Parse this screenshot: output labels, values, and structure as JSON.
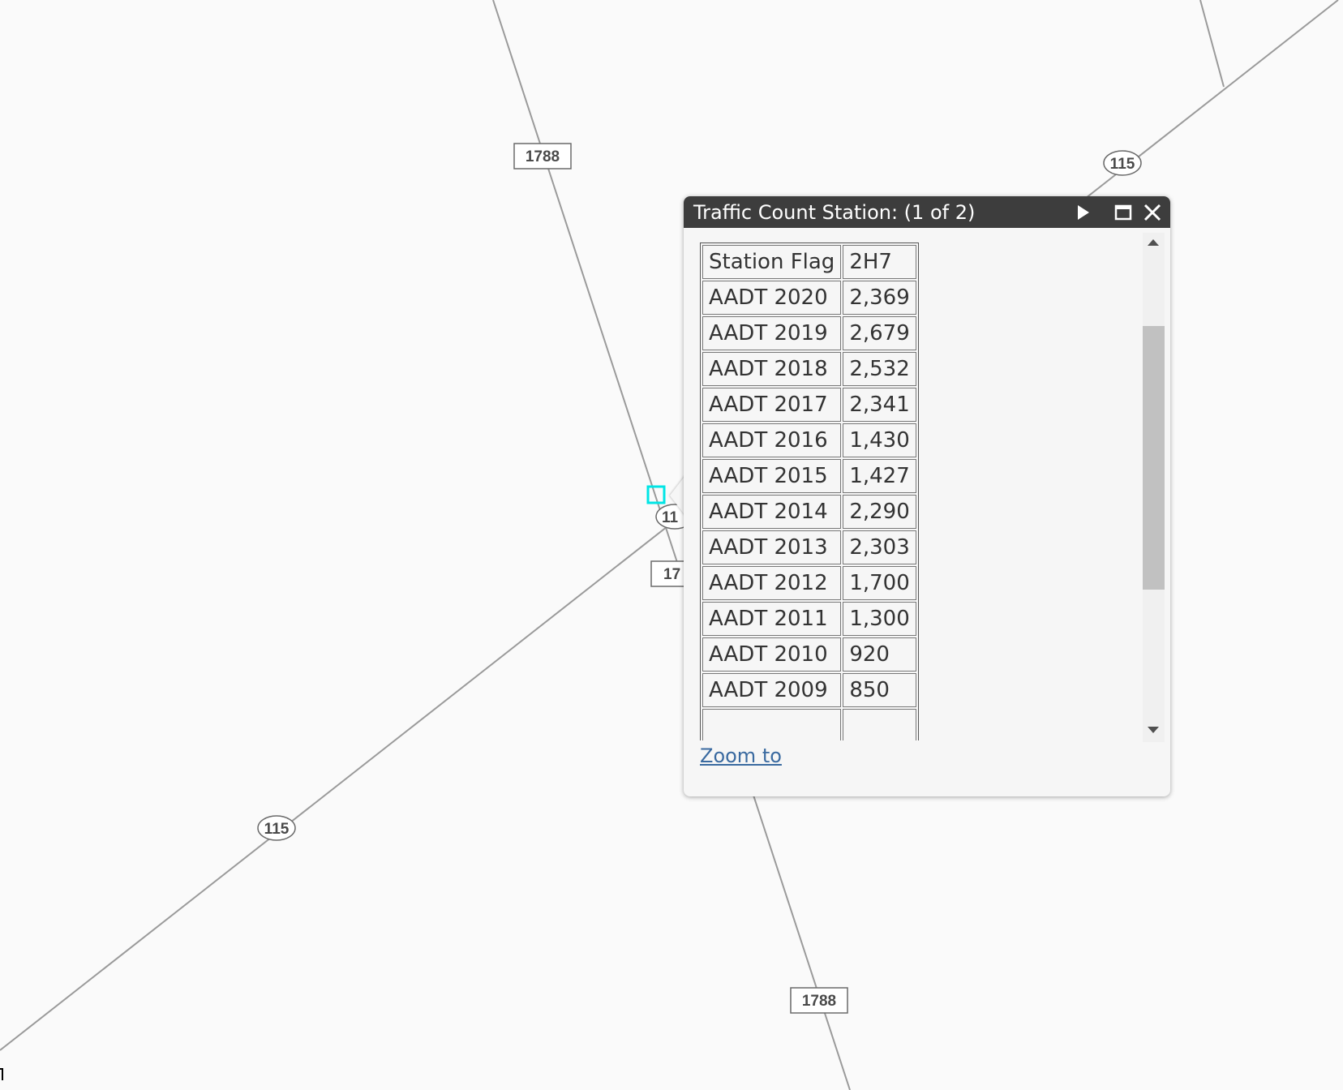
{
  "map": {
    "route_labels": {
      "farm_road_top": "1788",
      "farm_road_bottom": "1788",
      "farm_road_center_partial": "17",
      "highway_top_right": "115",
      "highway_lower_left": "115",
      "highway_center_partial": "11"
    },
    "colors": {
      "background": "#fafafa",
      "road": "#9a9a9a",
      "selection": "#00e5e5"
    }
  },
  "popup": {
    "title": "Traffic Count Station: (1 of 2)",
    "icons": {
      "next": "next-arrow-icon",
      "maximize": "maximize-icon",
      "close": "close-icon"
    },
    "rows": [
      {
        "label": "Station Flag",
        "value": "2H7"
      },
      {
        "label": "AADT 2020",
        "value": "2,369"
      },
      {
        "label": "AADT 2019",
        "value": "2,679"
      },
      {
        "label": "AADT 2018",
        "value": "2,532"
      },
      {
        "label": "AADT 2017",
        "value": "2,341"
      },
      {
        "label": "AADT 2016",
        "value": "1,430"
      },
      {
        "label": "AADT 2015",
        "value": "1,427"
      },
      {
        "label": "AADT 2014",
        "value": "2,290"
      },
      {
        "label": "AADT 2013",
        "value": "2,303"
      },
      {
        "label": "AADT 2012",
        "value": "1,700"
      },
      {
        "label": "AADT 2011",
        "value": "1,300"
      },
      {
        "label": "AADT 2010",
        "value": "920"
      },
      {
        "label": "AADT 2009",
        "value": "850"
      },
      {
        "label": "",
        "value": ""
      }
    ],
    "zoom_link": "Zoom to",
    "colors": {
      "header": "#3d3d3d",
      "body": "#f6f6f6",
      "link": "#3a6aa0"
    }
  }
}
